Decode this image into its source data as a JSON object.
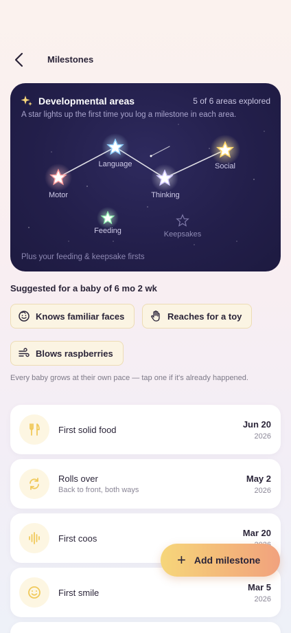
{
  "header": {
    "title": "Milestones",
    "back_icon": "chevron-left-icon"
  },
  "constellation": {
    "title": "Developmental areas",
    "explored": "5 of 6 areas explored",
    "subtitle": "A star lights up the first time you log a milestone in each area.",
    "footer": "Plus your feeding & keepsake firsts",
    "areas": [
      {
        "label": "Motor",
        "lit": true
      },
      {
        "label": "Language",
        "lit": true
      },
      {
        "label": "Thinking",
        "lit": true
      },
      {
        "label": "Social",
        "lit": true
      },
      {
        "label": "Feeding",
        "lit": true
      },
      {
        "label": "Keepsakes",
        "lit": false
      }
    ]
  },
  "suggested": {
    "heading": "Suggested for a baby of 6 mo 2 wk",
    "chips": [
      {
        "label": "Knows familiar faces",
        "icon": "smile-face-icon"
      },
      {
        "label": "Reaches for a toy",
        "icon": "hand-icon"
      },
      {
        "label": "Blows raspberries",
        "icon": "wind-icon"
      }
    ],
    "hint": "Every baby grows at their own pace — tap one if it's already happened."
  },
  "milestones": [
    {
      "title": "First solid food",
      "subtitle": "",
      "date": "Jun 20",
      "year": "2026",
      "icon": "fork-knife-icon"
    },
    {
      "title": "Rolls over",
      "subtitle": "Back to front, both ways",
      "date": "May 2",
      "year": "2026",
      "icon": "rotate-icon"
    },
    {
      "title": "First coos",
      "subtitle": "",
      "date": "Mar 20",
      "year": "2026",
      "icon": "sound-wave-icon"
    },
    {
      "title": "First smile",
      "subtitle": "",
      "date": "Mar 5",
      "year": "2026",
      "icon": "smile-icon"
    }
  ],
  "fab": {
    "label": "Add milestone",
    "icon": "plus-icon"
  },
  "colors": {
    "card_bg": "#231f4b",
    "chip_bg": "#fbf4e3",
    "accent": "#f4b879",
    "star": "#ffffff"
  }
}
